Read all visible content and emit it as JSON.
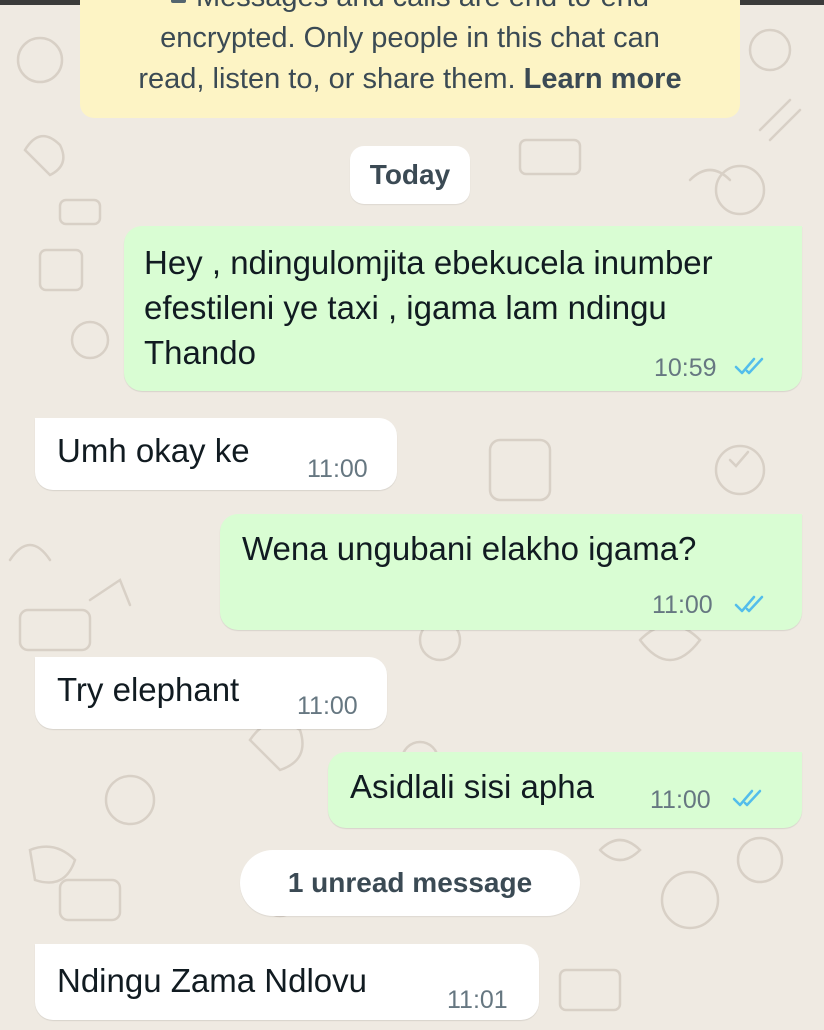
{
  "colors": {
    "background": "#efeae2",
    "outgoing_bubble": "#d9fdd3",
    "incoming_bubble": "#ffffff",
    "encryption_banner": "#fdf4c5",
    "read_ticks": "#53bdeb",
    "timestamp": "#667781"
  },
  "encryption_notice": {
    "icon": "lock-icon",
    "line1": "Messages and calls are end-to-end",
    "line2": "encrypted. Only people in this chat can",
    "line3": "read, listen to, or share them.",
    "link": "Learn more"
  },
  "date_separator": "Today",
  "messages": [
    {
      "direction": "outgoing",
      "text": "Hey  , ndingulomjita ebekucela inumber efestileni ye taxi , igama lam ndingu Thando",
      "time": "10:59",
      "status": "read",
      "status_icon": "double-check-icon"
    },
    {
      "direction": "incoming",
      "text": "Umh okay ke",
      "time": "11:00"
    },
    {
      "direction": "outgoing",
      "text": "Wena ungubani elakho igama?",
      "time": "11:00",
      "status": "read",
      "status_icon": "double-check-icon"
    },
    {
      "direction": "incoming",
      "text": "Try elephant",
      "time": "11:00"
    },
    {
      "direction": "outgoing",
      "text": "Asidlali sisi apha",
      "time": "11:00",
      "status": "read",
      "status_icon": "double-check-icon"
    },
    {
      "direction": "incoming",
      "text": "Ndingu Zama Ndlovu",
      "time": "11:01"
    }
  ],
  "unread_separator": "1 unread message"
}
